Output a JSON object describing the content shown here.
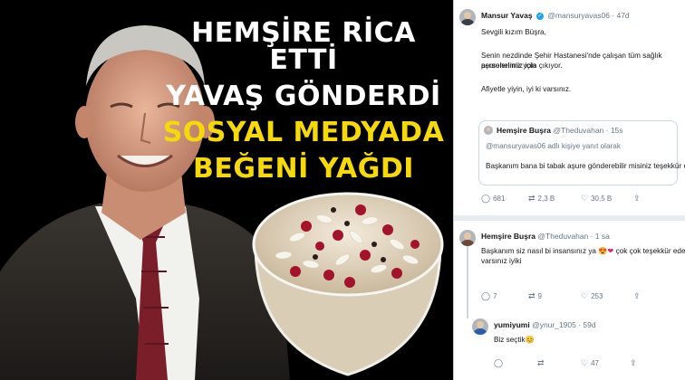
{
  "headline": {
    "line1": "HEMŞİRE RİCA ETTİ",
    "line2": "YAVAŞ GÖNDERDİ",
    "line3": "SOSYAL MEDYADA",
    "line4": "BEĞENİ YAĞDI"
  },
  "colors": {
    "headline_white": "#ffffff",
    "headline_yellow": "#f5d90a",
    "twitter_blue": "#1da1f2",
    "like_red": "#e0245e"
  },
  "tweet_main": {
    "name": "Mansur Yavaş",
    "handle": "@mansuryavas06 · 47d",
    "greeting": "Sevgili kızım Büşra,",
    "body1": "Senin nezdinde Şehir Hastanesi'nde çalışan tüm sağlık personelimiz için",
    "body2": "aşurelerimiz yola çıkıyor.",
    "body3": "Afiyetle yiyin, iyi ki varsınız.",
    "quote": {
      "name": "Hemşire Buşra",
      "handle": "@Theduvahan · 15s",
      "reply_to": "@mansuryavas06 adlı kişiye yanıt olarak",
      "text": "Başkanım bana bi tabak aşure gönderebilir misiniz teşekkür ederim"
    },
    "actions": {
      "replies": "681",
      "retweets": "2,3 B",
      "likes": "30,5 B"
    }
  },
  "tweet_reply1": {
    "name": "Hemşire Buşra",
    "handle": "@Theduvahan · 1 sa",
    "line1": "Başkanım siz nasıl bi insansınız ya",
    "line1b": "çok çok teşekkür ederim",
    "line1c": "iyiki",
    "line2": "varsınız iyiki",
    "actions": {
      "replies": "7",
      "retweets": "9",
      "likes": "253"
    }
  },
  "tweet_reply2": {
    "name": "yumiyumi",
    "handle": "@ynur_1905 · 59d",
    "text": "Biz seçtik",
    "actions": {
      "replies": "",
      "retweets": "",
      "likes": "47"
    }
  },
  "icons": [
    "reply-icon",
    "retweet-icon",
    "like-icon",
    "share-icon",
    "verified-icon",
    "heart-emoji-icon"
  ]
}
